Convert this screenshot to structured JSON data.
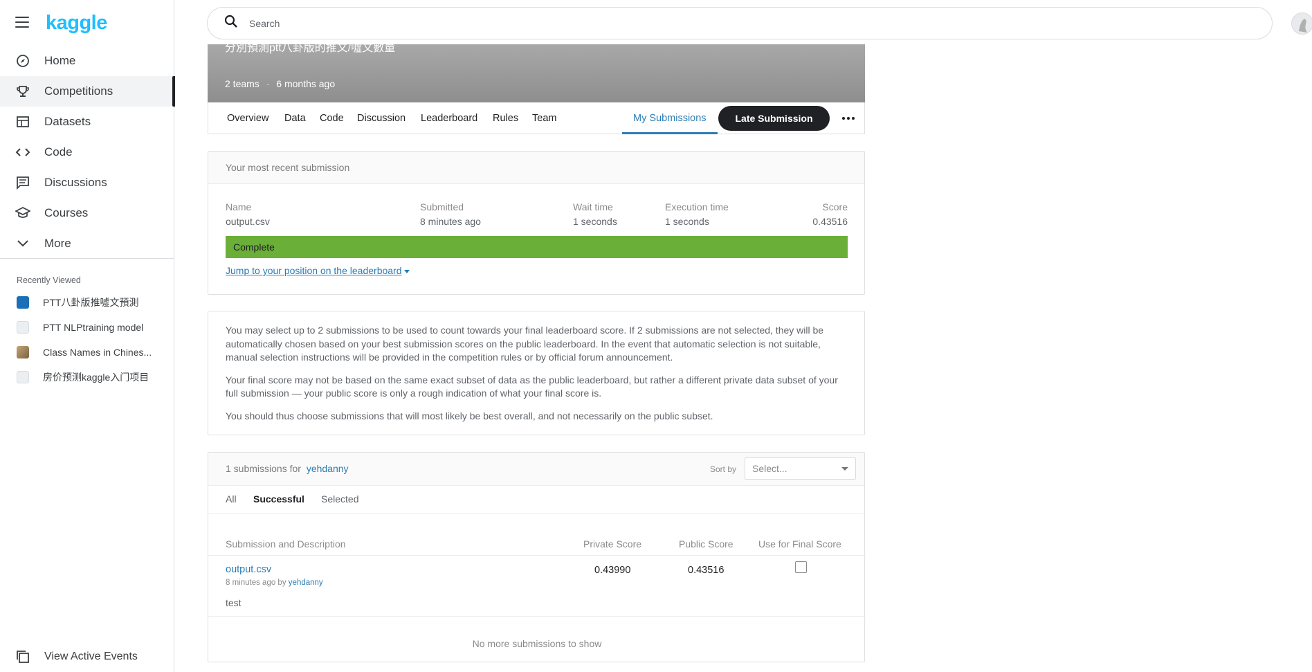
{
  "brand": {
    "logo": "kaggle"
  },
  "sidebar": {
    "items": [
      {
        "label": "Home",
        "icon": "compass-icon"
      },
      {
        "label": "Competitions",
        "icon": "trophy-icon"
      },
      {
        "label": "Datasets",
        "icon": "table-icon"
      },
      {
        "label": "Code",
        "icon": "code-icon"
      },
      {
        "label": "Discussions",
        "icon": "comments-icon"
      },
      {
        "label": "Courses",
        "icon": "school-icon"
      },
      {
        "label": "More",
        "icon": "chevron-down-icon"
      }
    ],
    "recent_title": "Recently Viewed",
    "recent": [
      {
        "label": "PTT八卦版推噓文預測",
        "color": "#1b6fb7"
      },
      {
        "label": "PTT NLPtraining model",
        "color": "#dadce0"
      },
      {
        "label": "Class Names in Chines...",
        "color": "#b89a6a"
      },
      {
        "label": "房价预测kaggle入门项目",
        "color": "#dadce0"
      }
    ],
    "bottom_label": "View Active Events"
  },
  "search": {
    "placeholder": "Search"
  },
  "hero": {
    "title": "分別預測ptt八卦版的推文/噓文數量",
    "teams": "2 teams",
    "dot": "·",
    "time": "6 months ago"
  },
  "tabs": {
    "items": [
      "Overview",
      "Data",
      "Code",
      "Discussion",
      "Leaderboard",
      "Rules",
      "Team"
    ],
    "my_submissions": "My Submissions",
    "late_submission": "Late Submission"
  },
  "recent_submission": {
    "heading": "Your most recent submission",
    "name_label": "Name",
    "name": "output.csv",
    "submitted_label": "Submitted",
    "submitted": "8 minutes ago",
    "wait_label": "Wait time",
    "wait": "1 seconds",
    "exec_label": "Execution time",
    "exec": "1 seconds",
    "score_label": "Score",
    "score": "0.43516",
    "status": "Complete",
    "status_color": "#6aaf37",
    "jump_link": "Jump to your position on the leaderboard"
  },
  "notes": {
    "p1": "You may select up to 2 submissions to be used to count towards your final leaderboard score. If 2 submissions are not selected, they will be automatically chosen based on your best submission scores on the public leaderboard. In the event that automatic selection is not suitable, manual selection instructions will be provided in the competition rules or by official forum announcement.",
    "p2": "Your final score may not be based on the same exact subset of data as the public leaderboard, but rather a different private data subset of your full submission — your public score is only a rough indication of what your final score is.",
    "p3": "You should thus choose submissions that will most likely be best overall, and not necessarily on the public subset."
  },
  "submissions": {
    "count_text": "1 submissions for",
    "user": "yehdanny",
    "sort_label": "Sort by",
    "sort_value": "Select...",
    "filters": [
      "All",
      "Successful",
      "Selected"
    ],
    "columns": {
      "desc": "Submission and Description",
      "private": "Private Score",
      "public": "Public Score",
      "final": "Use for Final Score"
    },
    "rows": [
      {
        "file": "output.csv",
        "meta_prefix": "8 minutes ago by",
        "user": "yehdanny",
        "description": "test",
        "private": "0.43990",
        "public": "0.43516"
      }
    ],
    "empty_text": "No more submissions to show"
  }
}
